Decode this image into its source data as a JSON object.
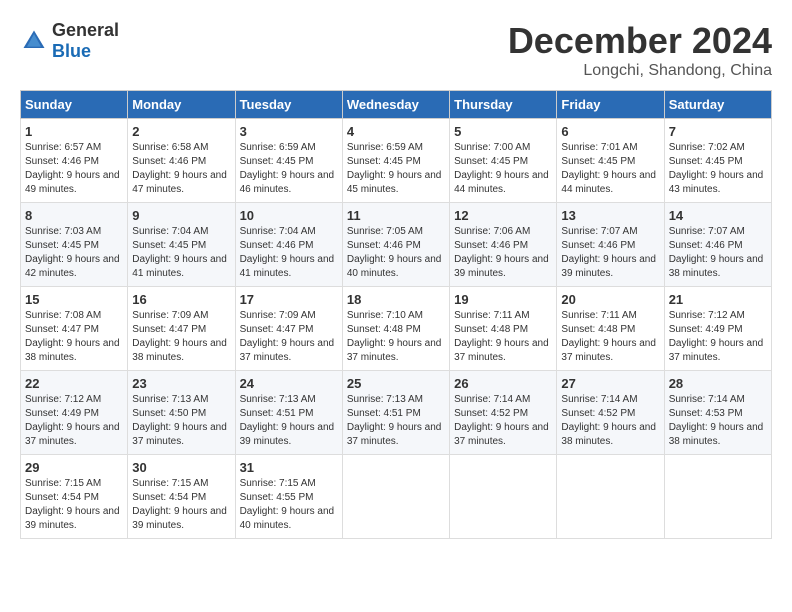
{
  "logo": {
    "general": "General",
    "blue": "Blue"
  },
  "title": "December 2024",
  "location": "Longchi, Shandong, China",
  "weekdays": [
    "Sunday",
    "Monday",
    "Tuesday",
    "Wednesday",
    "Thursday",
    "Friday",
    "Saturday"
  ],
  "weeks": [
    [
      {
        "day": "1",
        "sunrise": "6:57 AM",
        "sunset": "4:46 PM",
        "daylight": "9 hours and 49 minutes."
      },
      {
        "day": "2",
        "sunrise": "6:58 AM",
        "sunset": "4:46 PM",
        "daylight": "9 hours and 47 minutes."
      },
      {
        "day": "3",
        "sunrise": "6:59 AM",
        "sunset": "4:45 PM",
        "daylight": "9 hours and 46 minutes."
      },
      {
        "day": "4",
        "sunrise": "6:59 AM",
        "sunset": "4:45 PM",
        "daylight": "9 hours and 45 minutes."
      },
      {
        "day": "5",
        "sunrise": "7:00 AM",
        "sunset": "4:45 PM",
        "daylight": "9 hours and 44 minutes."
      },
      {
        "day": "6",
        "sunrise": "7:01 AM",
        "sunset": "4:45 PM",
        "daylight": "9 hours and 44 minutes."
      },
      {
        "day": "7",
        "sunrise": "7:02 AM",
        "sunset": "4:45 PM",
        "daylight": "9 hours and 43 minutes."
      }
    ],
    [
      {
        "day": "8",
        "sunrise": "7:03 AM",
        "sunset": "4:45 PM",
        "daylight": "9 hours and 42 minutes."
      },
      {
        "day": "9",
        "sunrise": "7:04 AM",
        "sunset": "4:45 PM",
        "daylight": "9 hours and 41 minutes."
      },
      {
        "day": "10",
        "sunrise": "7:04 AM",
        "sunset": "4:46 PM",
        "daylight": "9 hours and 41 minutes."
      },
      {
        "day": "11",
        "sunrise": "7:05 AM",
        "sunset": "4:46 PM",
        "daylight": "9 hours and 40 minutes."
      },
      {
        "day": "12",
        "sunrise": "7:06 AM",
        "sunset": "4:46 PM",
        "daylight": "9 hours and 39 minutes."
      },
      {
        "day": "13",
        "sunrise": "7:07 AM",
        "sunset": "4:46 PM",
        "daylight": "9 hours and 39 minutes."
      },
      {
        "day": "14",
        "sunrise": "7:07 AM",
        "sunset": "4:46 PM",
        "daylight": "9 hours and 38 minutes."
      }
    ],
    [
      {
        "day": "15",
        "sunrise": "7:08 AM",
        "sunset": "4:47 PM",
        "daylight": "9 hours and 38 minutes."
      },
      {
        "day": "16",
        "sunrise": "7:09 AM",
        "sunset": "4:47 PM",
        "daylight": "9 hours and 38 minutes."
      },
      {
        "day": "17",
        "sunrise": "7:09 AM",
        "sunset": "4:47 PM",
        "daylight": "9 hours and 37 minutes."
      },
      {
        "day": "18",
        "sunrise": "7:10 AM",
        "sunset": "4:48 PM",
        "daylight": "9 hours and 37 minutes."
      },
      {
        "day": "19",
        "sunrise": "7:11 AM",
        "sunset": "4:48 PM",
        "daylight": "9 hours and 37 minutes."
      },
      {
        "day": "20",
        "sunrise": "7:11 AM",
        "sunset": "4:48 PM",
        "daylight": "9 hours and 37 minutes."
      },
      {
        "day": "21",
        "sunrise": "7:12 AM",
        "sunset": "4:49 PM",
        "daylight": "9 hours and 37 minutes."
      }
    ],
    [
      {
        "day": "22",
        "sunrise": "7:12 AM",
        "sunset": "4:49 PM",
        "daylight": "9 hours and 37 minutes."
      },
      {
        "day": "23",
        "sunrise": "7:13 AM",
        "sunset": "4:50 PM",
        "daylight": "9 hours and 37 minutes."
      },
      {
        "day": "24",
        "sunrise": "7:13 AM",
        "sunset": "4:51 PM",
        "daylight": "9 hours and 39 minutes."
      },
      {
        "day": "25",
        "sunrise": "7:13 AM",
        "sunset": "4:51 PM",
        "daylight": "9 hours and 37 minutes."
      },
      {
        "day": "26",
        "sunrise": "7:14 AM",
        "sunset": "4:52 PM",
        "daylight": "9 hours and 37 minutes."
      },
      {
        "day": "27",
        "sunrise": "7:14 AM",
        "sunset": "4:52 PM",
        "daylight": "9 hours and 38 minutes."
      },
      {
        "day": "28",
        "sunrise": "7:14 AM",
        "sunset": "4:53 PM",
        "daylight": "9 hours and 38 minutes."
      }
    ],
    [
      {
        "day": "29",
        "sunrise": "7:15 AM",
        "sunset": "4:54 PM",
        "daylight": "9 hours and 39 minutes."
      },
      {
        "day": "30",
        "sunrise": "7:15 AM",
        "sunset": "4:54 PM",
        "daylight": "9 hours and 39 minutes."
      },
      {
        "day": "31",
        "sunrise": "7:15 AM",
        "sunset": "4:55 PM",
        "daylight": "9 hours and 40 minutes."
      },
      null,
      null,
      null,
      null
    ]
  ]
}
